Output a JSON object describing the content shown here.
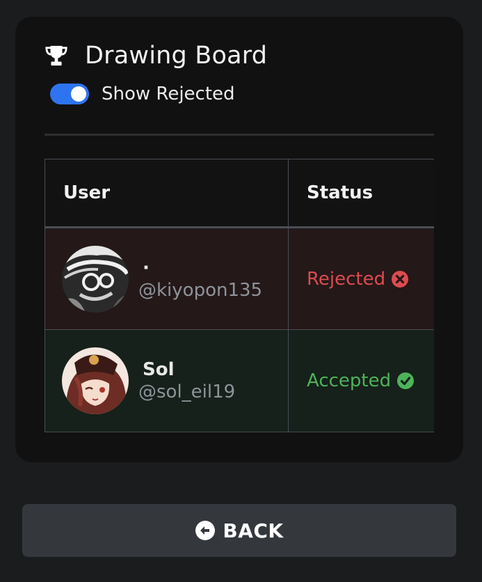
{
  "card": {
    "title": "Drawing Board",
    "title_icon": "trophy-icon",
    "toggle": {
      "label": "Show Rejected",
      "on": true,
      "color": "#2e74f0"
    }
  },
  "table": {
    "columns": [
      "User",
      "Status"
    ],
    "rows": [
      {
        "name": "·",
        "handle": "@kiyopon135",
        "status": "Rejected",
        "status_icon": "x-circle-icon",
        "status_color": "#dd4b4f"
      },
      {
        "name": "Sol",
        "handle": "@sol_eil19",
        "status": "Accepted",
        "status_icon": "check-circle-icon",
        "status_color": "#4db35a"
      }
    ]
  },
  "back_button": {
    "label": "BACK",
    "icon": "arrow-left-circle-icon"
  }
}
